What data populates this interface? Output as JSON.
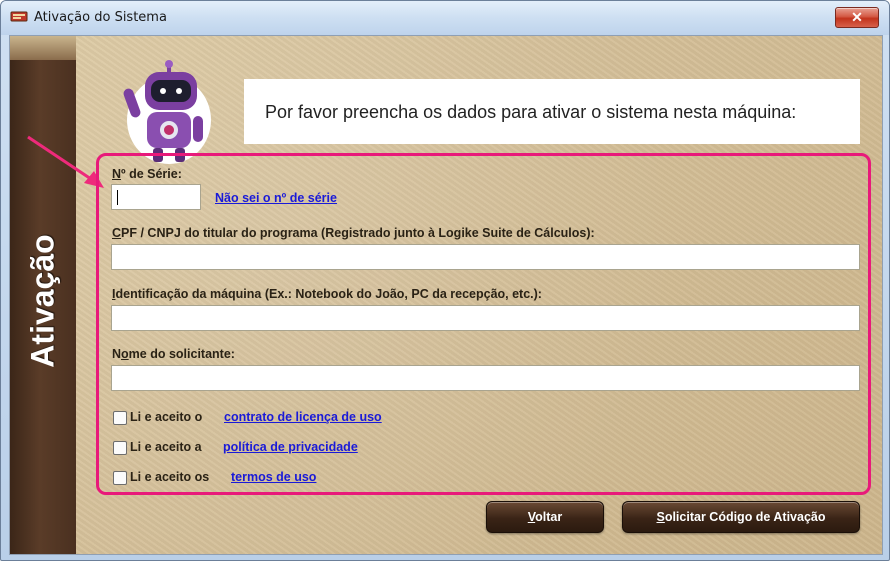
{
  "window": {
    "title": "Ativação do Sistema",
    "close_symbol": "✕"
  },
  "sidebar": {
    "label": "Ativação"
  },
  "header": {
    "message": "Por favor preencha os dados para ativar o sistema nesta máquina:"
  },
  "form": {
    "serial": {
      "label_mnemonic": "N",
      "label_rest": "º de Série:",
      "value": "",
      "help_link": "Não sei o nº de série"
    },
    "cpf": {
      "label_mnemonic": "C",
      "label_rest": "PF / CNPJ do titular do programa (Registrado junto à Logike Suite de Cálculos):",
      "value": ""
    },
    "machine": {
      "label_mnemonic": "I",
      "label_rest": "dentificação da máquina (Ex.: Notebook do João, PC da recepção, etc.):",
      "value": ""
    },
    "requester": {
      "label_pre": "N",
      "label_mnemonic": "o",
      "label_rest": "me do solicitante:",
      "value": ""
    },
    "agreements": [
      {
        "prefix": "Li e aceito o",
        "link": "contrato de licença de uso",
        "checked": false
      },
      {
        "prefix": "Li e aceito a",
        "link": "política de privacidade",
        "checked": false
      },
      {
        "prefix": "Li e aceito os",
        "link": "termos de uso",
        "checked": false
      }
    ]
  },
  "buttons": {
    "back": {
      "mnemonic": "V",
      "rest": "oltar"
    },
    "request": {
      "mnemonic": "S",
      "rest": "olicitar Código de Ativação"
    }
  },
  "colors": {
    "highlight": "#e8197a",
    "sidebar": "#4a3020",
    "link": "#1a1ad8",
    "robot": "#7b3fa0"
  },
  "icons": [
    "app-icon",
    "close-icon",
    "robot-mascot",
    "pointer-arrow"
  ]
}
